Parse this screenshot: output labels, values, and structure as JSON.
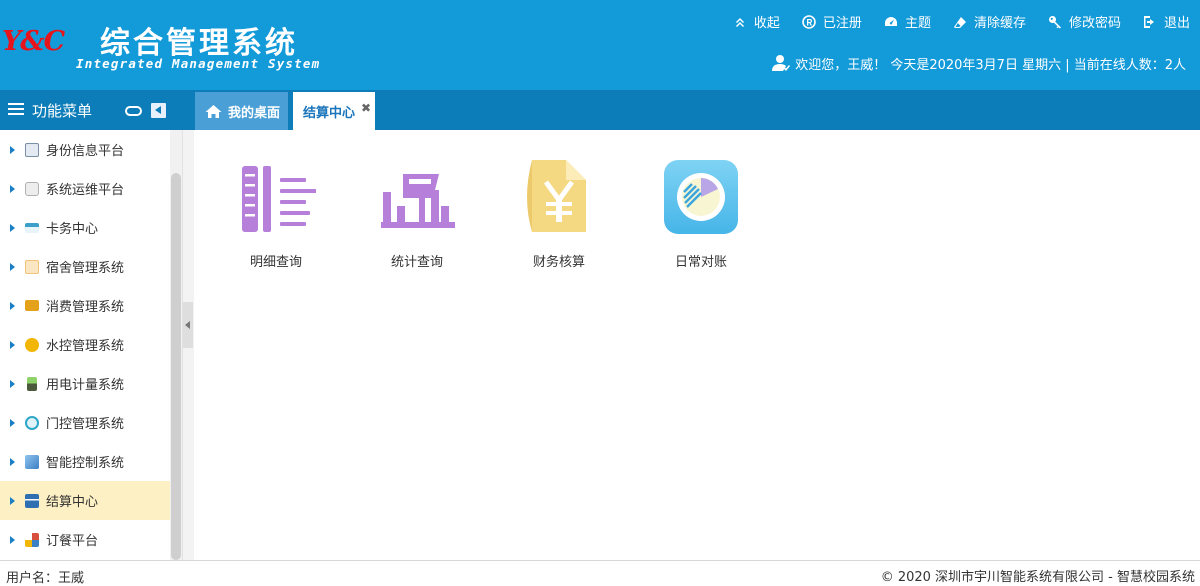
{
  "header": {
    "logo_mark": "Y&C",
    "title": "综合管理系统",
    "subtitle": "Integrated Management System",
    "top_nav": [
      {
        "label": "收起",
        "icon": "collapse-up-icon"
      },
      {
        "label": "已注册",
        "icon": "registered-icon"
      },
      {
        "label": "主题",
        "icon": "theme-dashboard-icon"
      },
      {
        "label": "清除缓存",
        "icon": "eraser-icon"
      },
      {
        "label": "修改密码",
        "icon": "key-icon"
      },
      {
        "label": "退出",
        "icon": "logout-icon"
      }
    ],
    "welcome": "欢迎您，王威！ 今天是2020年3月7日 星期六 | 当前在线人数：2人"
  },
  "sidebar": {
    "title": "功能菜单",
    "items": [
      {
        "label": "身份信息平台",
        "icon": "monitor-icon",
        "color": "#7a8fa6"
      },
      {
        "label": "系统运维平台",
        "icon": "gear-box-icon",
        "color": "#b0b0b0"
      },
      {
        "label": "卡务中心",
        "icon": "card-icon",
        "color": "#3aa0c8"
      },
      {
        "label": "宿舍管理系统",
        "icon": "dorm-icon",
        "color": "#f0c27a"
      },
      {
        "label": "消费管理系统",
        "icon": "wallet-icon",
        "color": "#e3a21a"
      },
      {
        "label": "水控管理系统",
        "icon": "water-icon",
        "color": "#f2b705"
      },
      {
        "label": "用电计量系统",
        "icon": "meter-icon",
        "color": "#4a5a3a"
      },
      {
        "label": "门控管理系统",
        "icon": "door-icon",
        "color": "#2fa7c9"
      },
      {
        "label": "智能控制系统",
        "icon": "screen-icon",
        "color": "#3b7fc4"
      },
      {
        "label": "结算中心",
        "icon": "calculator-icon",
        "color": "#2d6fb0",
        "active": true
      },
      {
        "label": "订餐平台",
        "icon": "meal-icon",
        "color": "#d94f3d"
      }
    ]
  },
  "tabs": {
    "home": "我的桌面",
    "current": "结算中心",
    "close": "✖"
  },
  "desktop": {
    "apps": [
      {
        "label": "明细查询",
        "icon": "detail-list-icon",
        "color": "#b57fda"
      },
      {
        "label": "统计查询",
        "icon": "statistics-icon",
        "color": "#b57fda"
      },
      {
        "label": "财务核算",
        "icon": "finance-yen-icon",
        "color": "#f4d982"
      },
      {
        "label": "日常对账",
        "icon": "reconcile-chart-icon",
        "color": "#5bc4ee"
      }
    ]
  },
  "footer": {
    "user": "用户名：王威",
    "copyright": "© 2020 深圳市宇川智能系统有限公司 - 智慧校园系统"
  },
  "colors": {
    "header_bg": "#139ad8",
    "bar_bg": "#0c7db8",
    "active_item_bg": "#fdf0c4",
    "logo_red": "#e8141b"
  }
}
